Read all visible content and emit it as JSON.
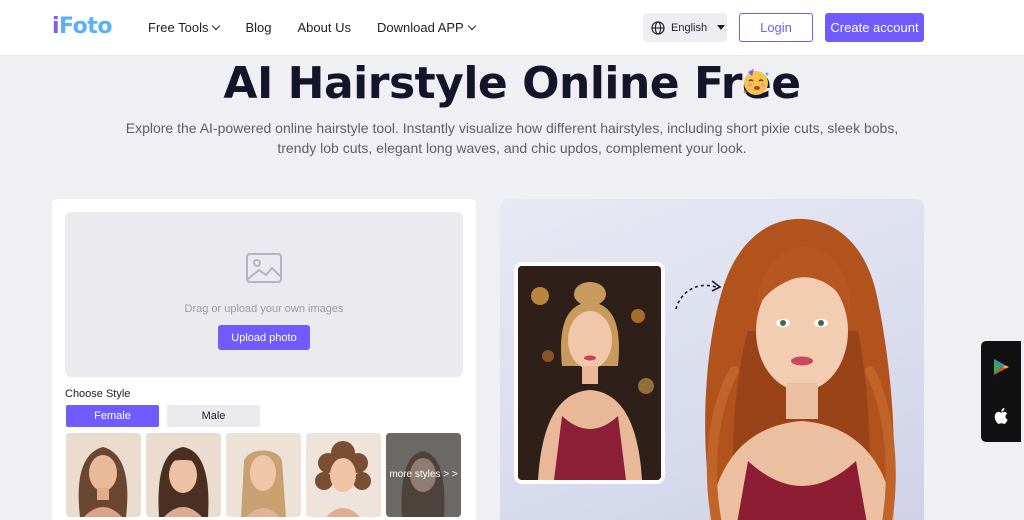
{
  "header": {
    "logo_text_1": "i",
    "logo_text_2": "Foto",
    "nav": [
      {
        "label": "Free Tools",
        "has_dropdown": true
      },
      {
        "label": "Blog",
        "has_dropdown": false
      },
      {
        "label": "About Us",
        "has_dropdown": false
      },
      {
        "label": "Download APP",
        "has_dropdown": true
      }
    ],
    "language": {
      "icon": "globe-icon",
      "label": "English"
    },
    "login_label": "Login",
    "create_account_label": "Create account"
  },
  "hero": {
    "title": "AI Hairstyle Online Free",
    "emoji_icon": "party-face-icon",
    "subtitle": "Explore the AI-powered online hairstyle tool. Instantly visualize how different hairstyles, including short pixie cuts, sleek bobs, trendy lob cuts, elegant long waves, and chic updos, complement your look."
  },
  "upload_panel": {
    "icon": "image-placeholder-icon",
    "hint": "Drag or upload your own images",
    "button_label": "Upload photo",
    "choose_style_label": "Choose Style",
    "tabs": [
      {
        "label": "Female",
        "active": true
      },
      {
        "label": "Male",
        "active": false
      }
    ],
    "style_thumbnails": [
      {
        "name": "long-wavy-hairstyle"
      },
      {
        "name": "bangs-hairstyle"
      },
      {
        "name": "sleek-straight-hairstyle"
      },
      {
        "name": "short-curly-hairstyle"
      }
    ],
    "more_styles_label": "more styles > >"
  },
  "preview": {
    "original_image": "original-photo-updo",
    "result_image": "result-photo-long-red-waves",
    "arrow_icon": "dashed-arrow-icon"
  },
  "store_widget": {
    "icons": [
      "google-play-icon",
      "apple-icon"
    ]
  },
  "colors": {
    "accent": "#6f5bff",
    "page_background": "#f0f0f4",
    "logo_purple": "#7a5cff",
    "logo_blue": "#5ab0ff"
  }
}
